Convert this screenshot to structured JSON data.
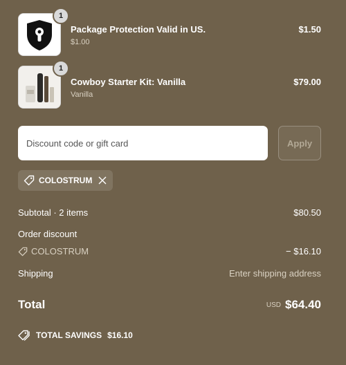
{
  "items": [
    {
      "title": "Package Protection Valid in US.",
      "subtitle": "$1.00",
      "price": "$1.50",
      "quantity": "1"
    },
    {
      "title": "Cowboy Starter Kit: Vanilla",
      "subtitle": "Vanilla",
      "price": "$79.00",
      "quantity": "1"
    }
  ],
  "discount": {
    "placeholder": "Discount code or gift card",
    "apply_label": "Apply"
  },
  "applied_code": "COLOSTRUM",
  "summary": {
    "subtotal_label": "Subtotal · 2 items",
    "subtotal_value": "$80.50",
    "order_discount_label": "Order discount",
    "discount_code": "COLOSTRUM",
    "discount_value": "− $16.10",
    "shipping_label": "Shipping",
    "shipping_value": "Enter shipping address",
    "total_label": "Total",
    "currency": "USD",
    "total_value": "$64.40",
    "savings_label": "TOTAL SAVINGS",
    "savings_value": "$16.10"
  },
  "colors": {
    "background": "#6f614b",
    "text": "#ffffff",
    "muted": "#d9d1c2"
  }
}
